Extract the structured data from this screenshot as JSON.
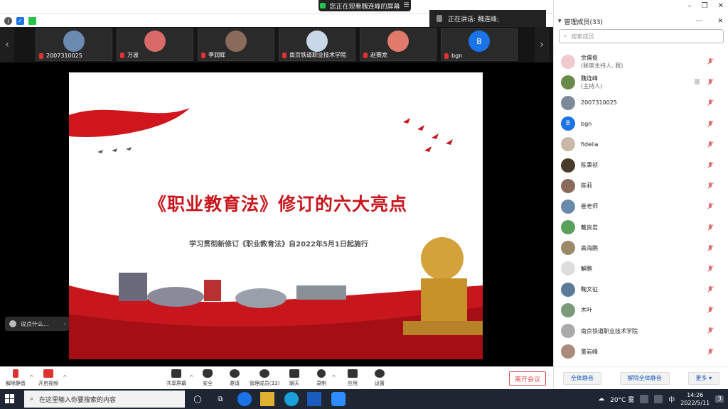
{
  "topbar": {
    "viewing_text": "您正在观看魏连峰的屏幕",
    "speaking_text": "正在讲话: 魏连峰;"
  },
  "thumbnails": [
    {
      "name": "2007310025"
    },
    {
      "name": "万波"
    },
    {
      "name": "李润辉"
    },
    {
      "name": "南京铁道职业技术学院"
    },
    {
      "name": "赵赛龙"
    },
    {
      "name": "bgn",
      "initial": "B"
    }
  ],
  "slide": {
    "title": "《职业教育法》修订的六大亮点",
    "subtitle": "学习贯彻新修订《职业教育法》自2022年5月1日起施行"
  },
  "chat": {
    "placeholder": "说点什么..."
  },
  "toolbar": {
    "unmute": "解除静音",
    "start_video": "开启视频",
    "share": "共享屏幕",
    "security": "安全",
    "invite": "邀请",
    "manage": "管理成员(33)",
    "chat": "聊天",
    "record": "录制",
    "apps": "应用",
    "settings": "设置",
    "leave": "离开会议"
  },
  "panel": {
    "title": "管理成员(33)",
    "search_placeholder": "搜索成员",
    "members": [
      {
        "name": "余儒俊",
        "role": "(联席主持人, 我)",
        "color": "#f0c8d0"
      },
      {
        "name": "魏连峰",
        "role": "(主持人)",
        "color": "#6a8a4a"
      },
      {
        "name": "2007310025",
        "role": "",
        "color": "#7a8a9a"
      },
      {
        "name": "bgn",
        "role": "",
        "color": "#1a73e8",
        "initial": "B"
      },
      {
        "name": "fidelia",
        "role": "",
        "color": "#c9b8a8"
      },
      {
        "name": "陈秉祯",
        "role": "",
        "color": "#4a3a2a"
      },
      {
        "name": "陈莉",
        "role": "",
        "color": "#8a6a5a"
      },
      {
        "name": "崔老师",
        "role": "",
        "color": "#6a8aaa"
      },
      {
        "name": "戴良岩",
        "role": "",
        "color": "#5aa05a"
      },
      {
        "name": "高海鹏",
        "role": "",
        "color": "#9a8a6a"
      },
      {
        "name": "解鹏",
        "role": "",
        "color": "#ddd"
      },
      {
        "name": "鞠文征",
        "role": "",
        "color": "#5a7a9a"
      },
      {
        "name": "木叶",
        "role": "",
        "color": "#7a9a7a"
      },
      {
        "name": "南京铁道职业技术学院",
        "role": "",
        "color": "#aaaaaa"
      },
      {
        "name": "董岩峰",
        "role": "",
        "color": "#aa8a7a"
      }
    ],
    "mute_all": "全体静音",
    "unmute_all": "解除全体静音",
    "more": "更多 ▾"
  },
  "taskbar": {
    "search_placeholder": "在这里输入你要搜索的内容",
    "weather": "20°C 雾",
    "ime": "中",
    "time": "14:26",
    "date": "2022/5/11",
    "notifications": "3"
  }
}
